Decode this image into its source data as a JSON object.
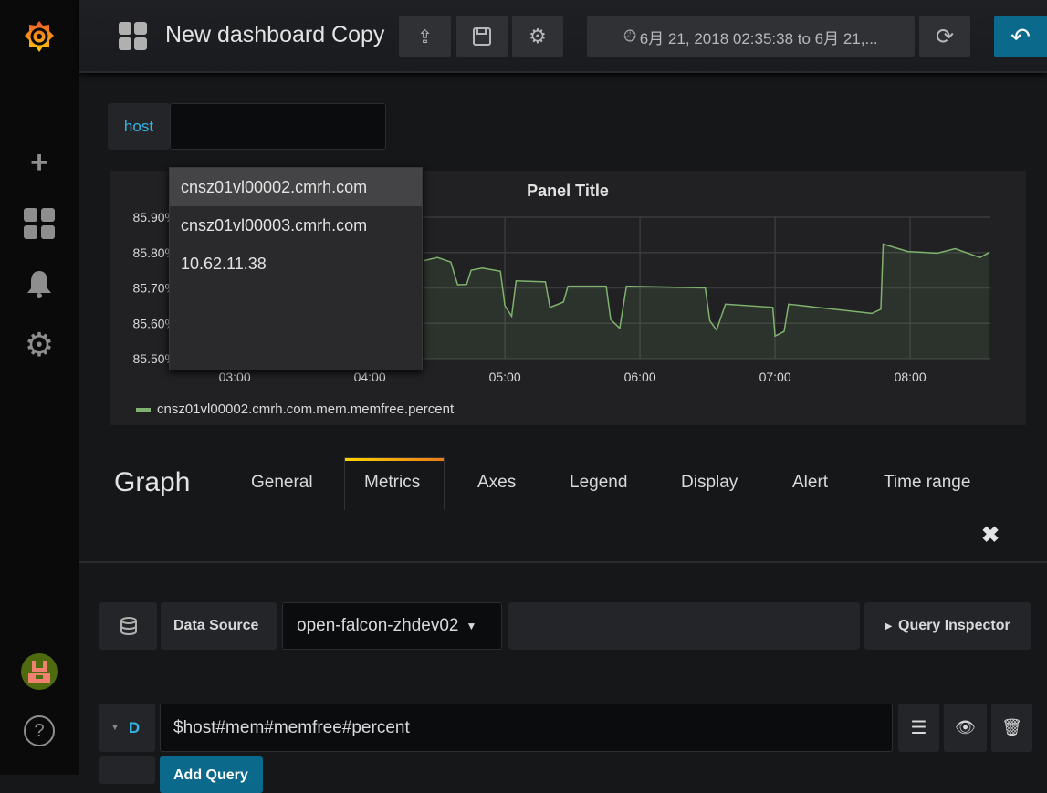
{
  "sidebar": {
    "items": [
      {
        "icon": "grafana-logo-icon"
      },
      {
        "icon": "plus-icon"
      },
      {
        "icon": "dashboards-icon"
      },
      {
        "icon": "bell-icon"
      },
      {
        "icon": "gear-icon"
      },
      {
        "icon": "avatar"
      },
      {
        "icon": "help-icon"
      }
    ]
  },
  "topbar": {
    "title": "New dashboard Copy",
    "time_range": "6月 21, 2018 02:35:38 to 6月 21,...",
    "buttons": [
      "share-icon",
      "save-icon",
      "settings-icon",
      "refresh-icon",
      "back-icon"
    ]
  },
  "variable": {
    "label": "host",
    "value": "",
    "options": [
      "cnsz01vl00002.cmrh.com",
      "cnsz01vl00003.cmrh.com",
      "10.62.11.38"
    ],
    "highlighted": 0
  },
  "panel": {
    "title": "Panel Title"
  },
  "editor": {
    "title": "Graph",
    "tabs": [
      "General",
      "Metrics",
      "Axes",
      "Legend",
      "Display",
      "Alert",
      "Time range"
    ],
    "active_tab": "Metrics",
    "close_icon": "close-icon"
  },
  "metrics": {
    "datasource_label": "Data Source",
    "datasource": "open-falcon-zhdev02",
    "query_inspector": "Query Inspector",
    "query_ref": "D",
    "query": "$host#mem#memfree#percent",
    "add_query": "Add Query"
  },
  "colors": {
    "accent": "#33b5e5",
    "series": "#7eb26d",
    "primary_button": "#0b6a8b",
    "tab_highlight": "#eb7b18"
  },
  "chart_data": {
    "type": "line",
    "title": "Panel Title",
    "x_ticks": [
      "03:00",
      "04:00",
      "05:00",
      "06:00",
      "07:00",
      "08:00"
    ],
    "y_ticks": [
      "85.50%",
      "85.60%",
      "85.70%",
      "85.80%",
      "85.90%"
    ],
    "xlim": [
      "02:35:38",
      "08:35:38"
    ],
    "ylim": [
      85.5,
      85.9
    ],
    "grid": true,
    "legend": "bottom-left",
    "series": [
      {
        "name": "cnsz01vl00002.cmrh.com.mem.memfree.percent",
        "color": "#7eb26d",
        "fill": true,
        "points": [
          [
            "04:24",
            85.777
          ],
          [
            "04:30",
            85.786
          ],
          [
            "04:36",
            85.773
          ],
          [
            "04:39",
            85.709
          ],
          [
            "04:43",
            85.71
          ],
          [
            "04:45",
            85.75
          ],
          [
            "04:50",
            85.756
          ],
          [
            "04:58",
            85.747
          ],
          [
            "05:00",
            85.65
          ],
          [
            "05:03",
            85.62
          ],
          [
            "05:05",
            85.72
          ],
          [
            "05:18",
            85.717
          ],
          [
            "05:20",
            85.645
          ],
          [
            "05:26",
            85.66
          ],
          [
            "05:28",
            85.705
          ],
          [
            "05:45",
            85.705
          ],
          [
            "05:47",
            85.611
          ],
          [
            "05:51",
            85.586
          ],
          [
            "05:54",
            85.705
          ],
          [
            "06:29",
            85.7
          ],
          [
            "06:31",
            85.607
          ],
          [
            "06:34",
            85.581
          ],
          [
            "06:38",
            85.654
          ],
          [
            "06:59",
            85.645
          ],
          [
            "07:00",
            85.564
          ],
          [
            "07:04",
            85.577
          ],
          [
            "07:06",
            85.654
          ],
          [
            "07:43",
            85.628
          ],
          [
            "07:47",
            85.64
          ],
          [
            "07:48",
            85.824
          ],
          [
            "07:59",
            85.803
          ],
          [
            "08:12",
            85.798
          ],
          [
            "08:20",
            85.811
          ],
          [
            "08:31",
            85.786
          ],
          [
            "08:35",
            85.8
          ]
        ]
      }
    ]
  }
}
